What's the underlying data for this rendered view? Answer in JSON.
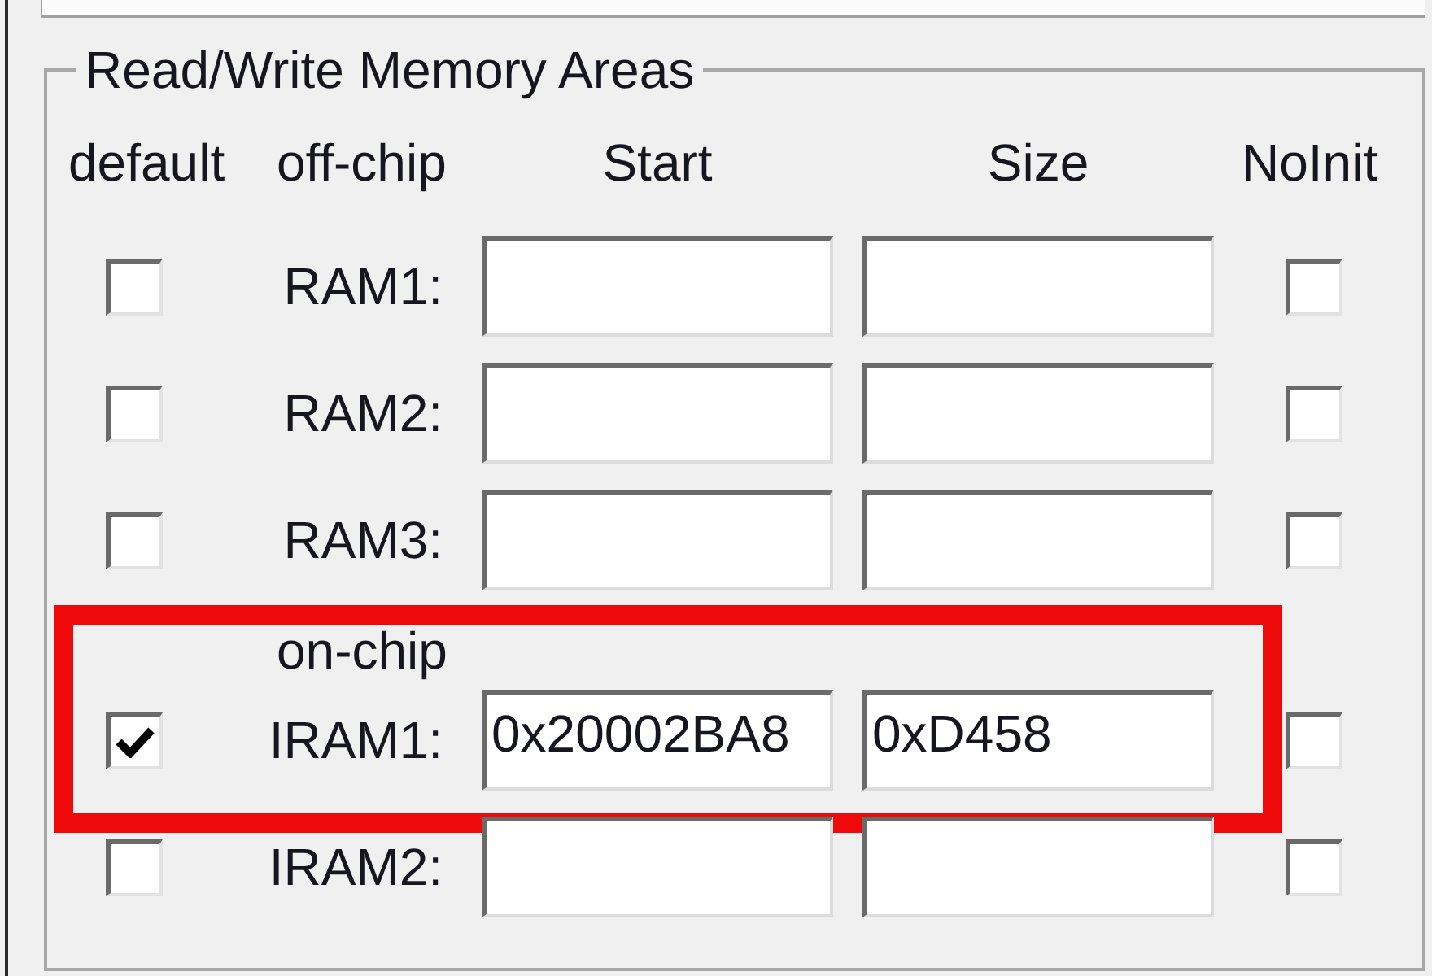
{
  "group": {
    "title": "Read/Write Memory Areas"
  },
  "columns": [
    {
      "kind": "default",
      "label": "default"
    },
    {
      "kind": "start",
      "label": "Start"
    },
    {
      "kind": "size",
      "label": "Size"
    },
    {
      "kind": "noinit",
      "label": "NoInit"
    }
  ],
  "sections": [
    {
      "label": "off-chip",
      "rows": [
        {
          "label": "RAM1:",
          "default_checked": false,
          "noinit_checked": false,
          "highlighted": false
        },
        {
          "label": "RAM2:",
          "default_checked": false,
          "noinit_checked": false,
          "highlighted": false
        },
        {
          "label": "RAM3:",
          "default_checked": false,
          "noinit_checked": false,
          "highlighted": false
        }
      ]
    },
    {
      "label": "on-chip",
      "rows": [
        {
          "label": "IRAM1:",
          "default_checked": true,
          "start": "0x20002BA8",
          "size": "0xD458",
          "noinit_checked": false,
          "highlighted": true
        },
        {
          "label": "IRAM2:",
          "default_checked": false,
          "noinit_checked": false,
          "highlighted": false
        }
      ]
    }
  ]
}
